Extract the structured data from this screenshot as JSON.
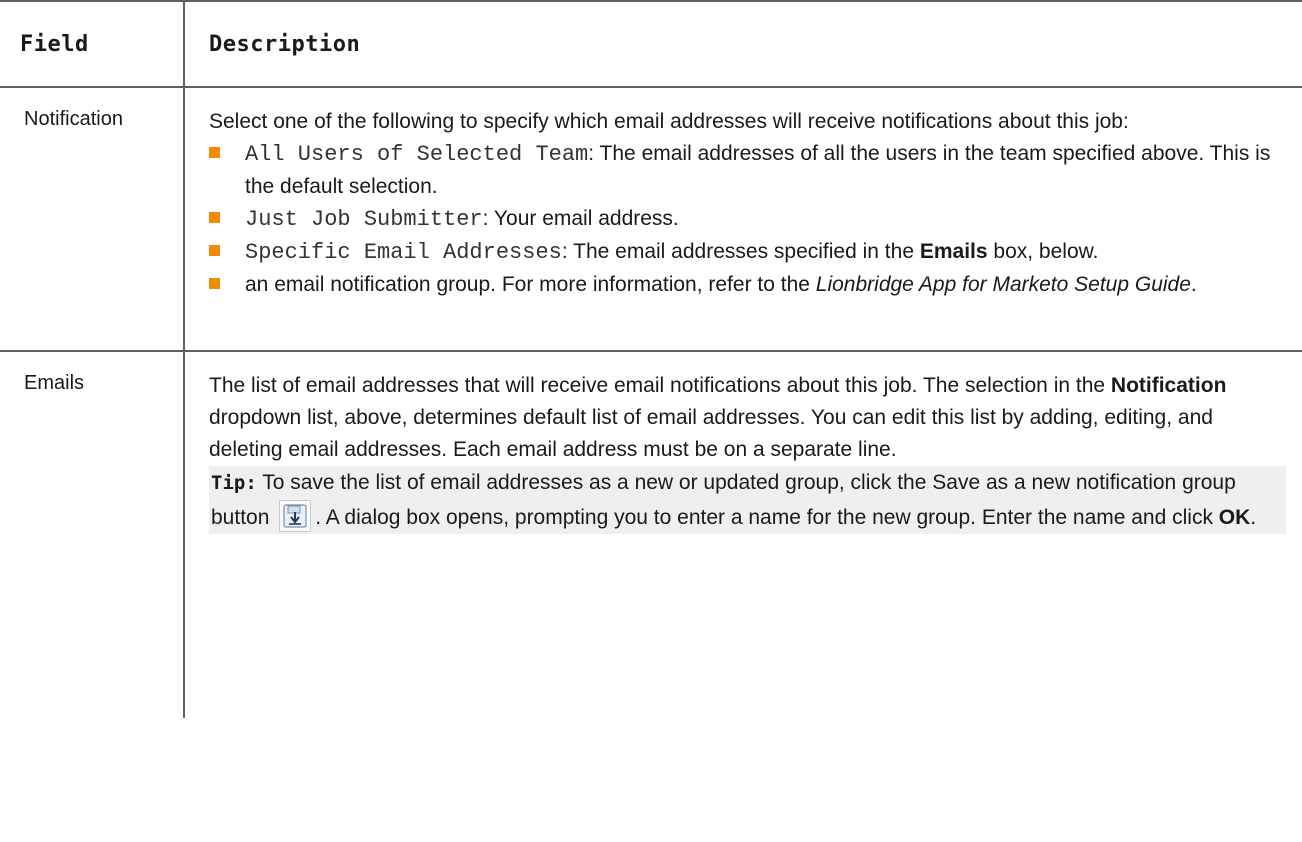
{
  "header": {
    "field": "Field",
    "description": "Description"
  },
  "rows": [
    {
      "field": "Notification",
      "intro": "Select one of the following to specify which email addresses will receive notifications about this job:",
      "options": [
        {
          "code": "All Users of Selected Team",
          "text": ": The email addresses of all the users in the team specified above. This is the default selection."
        },
        {
          "code": "Just Job Submitter",
          "text": ": Your email address."
        },
        {
          "code": "Specific Email Addresses",
          "text_before": ": The email addresses specified in the ",
          "bold": "Emails",
          "text_after": " box, below."
        }
      ],
      "group_option": {
        "text_before": "an email notification group. For more information, refer to the ",
        "italic": "Lionbridge App for Marketo Setup Guide",
        "text_after": "."
      }
    },
    {
      "field": "Emails",
      "para_before": "The list of email addresses that will receive email notifications about this job. The selection in the ",
      "para_bold": "Notification",
      "para_after": " dropdown list, above, determines default list of email addresses. You can edit this list by adding, editing, and deleting email addresses. Each email address must be on a separate line.",
      "tip": {
        "label": "Tip:",
        "text_before": " To save the list of email addresses as a new or updated group, click the Save as a new notification group button ",
        "icon": "save-notification-group-icon",
        "text_middle": ". A dialog box opens, prompting you to enter a name for the new group. Enter the name and click ",
        "bold": "OK",
        "text_after": "."
      }
    }
  ],
  "colors": {
    "bullet": "#f08c00",
    "border": "#606060",
    "tip_background": "#efefef"
  }
}
